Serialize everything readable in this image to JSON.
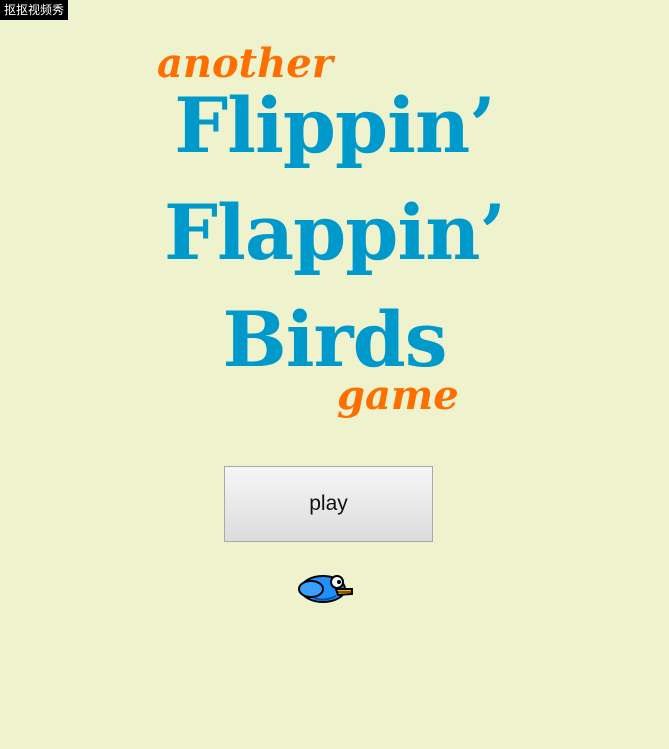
{
  "watermark": {
    "text": "抠抠视频秀"
  },
  "title": {
    "line_another": "another",
    "line_flippin": "Flippin’",
    "line_flappin": "Flappin’",
    "line_birds": "Birds",
    "line_game": "game"
  },
  "menu": {
    "play_label": "play"
  },
  "icons": {
    "bird": "bird-icon"
  },
  "colors": {
    "background": "#eef3cd",
    "title_blue": "#0099cc",
    "title_orange": "#ff6f00",
    "bird_blue": "#1e90ff"
  }
}
